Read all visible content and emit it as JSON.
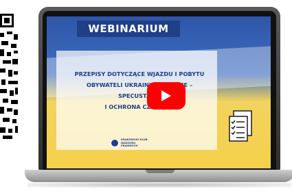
{
  "banner": {
    "label": "WEBINARIUM"
  },
  "title": {
    "line1": "PRZEPISY DOTYCZĄCE WJAZDU I POBYTU",
    "line2": "OBYWATELI UKRAINY W POLSCE –",
    "line3": "SPECUSTAWA",
    "line4": "I OCHRONA CZASOWA"
  },
  "org": {
    "line1": "KRAKOWSKI KLUB",
    "line2": "NADZORU PRAWNYCH"
  },
  "colors": {
    "flag_blue": "#3f6fc0",
    "flag_yellow": "#f5d04a",
    "banner": "#1f3f86",
    "play": "#ff0000"
  },
  "icons": [
    "qr-code-icon",
    "play-icon",
    "document-checklist-icon",
    "organization-logo-icon"
  ]
}
